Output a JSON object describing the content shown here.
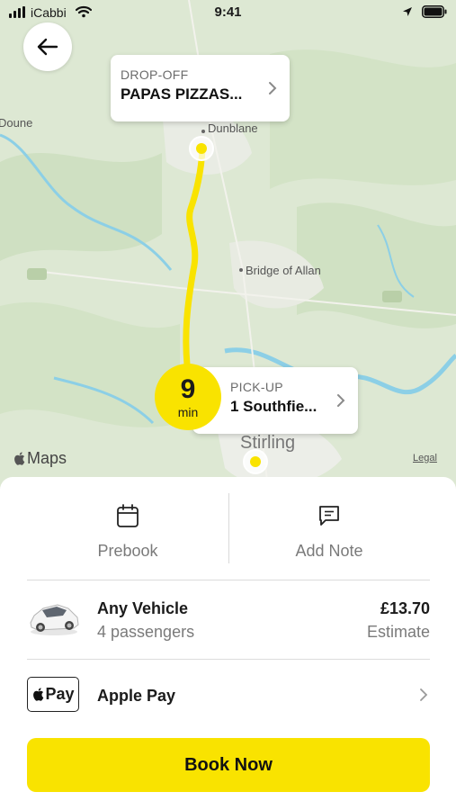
{
  "status_bar": {
    "carrier": "iCabbi",
    "time": "9:41"
  },
  "map": {
    "places": {
      "doune": "Doune",
      "dunblane": "Dunblane",
      "bridge_of_allan": "Bridge of Allan",
      "stirling": "Stirling"
    },
    "brand": "Maps",
    "legal": "Legal",
    "dropoff": {
      "label": "DROP-OFF",
      "value": "PAPAS PIZZAS..."
    },
    "pickup": {
      "label": "PICK-UP",
      "value": "1 Southfie..."
    },
    "eta": {
      "value": "9",
      "unit": "min"
    },
    "route_color": "#f9e300",
    "water_color": "#8ccfe6"
  },
  "actions": {
    "prebook": "Prebook",
    "add_note": "Add Note"
  },
  "vehicle": {
    "name": "Any Vehicle",
    "passengers": "4 passengers",
    "price": "£13.70",
    "price_note": "Estimate"
  },
  "payment": {
    "badge": "Pay",
    "method": "Apple Pay"
  },
  "book_button": "Book Now",
  "accent_color": "#f9e300"
}
